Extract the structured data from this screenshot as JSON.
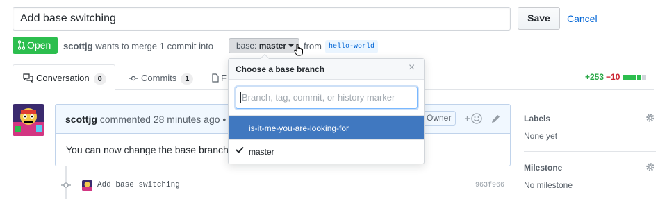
{
  "title_input": {
    "value": "Add base switching"
  },
  "buttons": {
    "save": "Save",
    "cancel": "Cancel"
  },
  "state": {
    "label": "Open",
    "color": "#2cbe4e"
  },
  "merge_info": {
    "author": "scottjg",
    "text": " wants to merge 1 commit into",
    "base_prefix": "base: ",
    "base_branch": "master",
    "from_text": "from",
    "head_branch": "hello-world"
  },
  "tabs": [
    {
      "label": "Conversation",
      "count": "0",
      "icon": "comment-discussion-icon"
    },
    {
      "label": "Commits",
      "count": "1",
      "icon": "git-commit-icon"
    },
    {
      "label": "F",
      "icon": "file-diff-icon"
    }
  ],
  "diffstat": {
    "added": "+253",
    "removed": "−10",
    "blocks": [
      "#2cbe4e",
      "#2cbe4e",
      "#2cbe4e",
      "#2cbe4e",
      "#d1d5da"
    ]
  },
  "comment": {
    "author": "scottjg",
    "meta": " commented 28 minutes ago •",
    "owner_label": "Owner",
    "body": "You can now change the base branch"
  },
  "timeline_commit": {
    "message": "Add base switching",
    "sha": "963f966"
  },
  "sidebar": {
    "labels_heading": "Labels",
    "labels_value": "None yet",
    "milestone_heading": "Milestone",
    "milestone_value": "No milestone"
  },
  "dropdown": {
    "title": "Choose a base branch",
    "close_glyph": "×",
    "filter_placeholder": "Branch, tag, commit, or history marker",
    "items": [
      {
        "label": "is-it-me-you-are-looking-for",
        "selected_highlight": true
      },
      {
        "label": "master",
        "checked": true
      }
    ],
    "highlight_color": "#4078c0"
  },
  "colors": {
    "link": "#0366d6",
    "accent_blue": "#4078c0",
    "green": "#28a745",
    "red": "#cb2431"
  }
}
